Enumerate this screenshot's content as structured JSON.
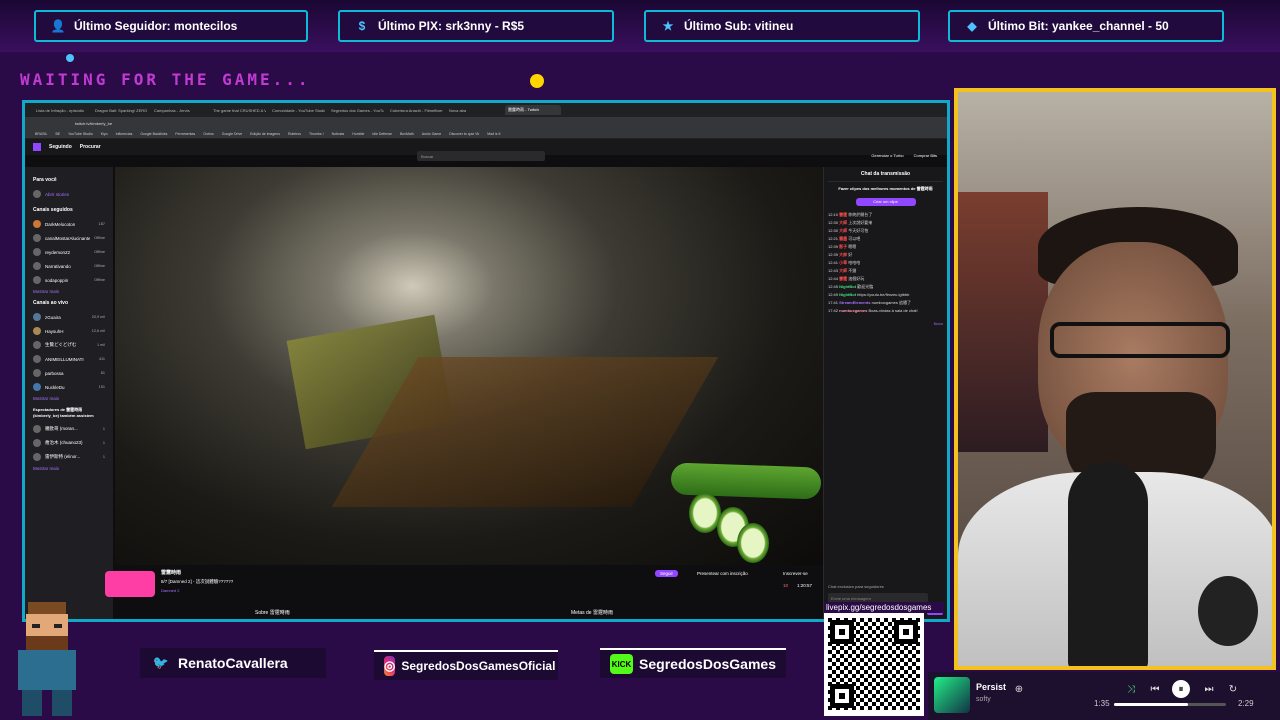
{
  "alerts": [
    {
      "icon": "user-icon",
      "label": "Último Seguidor: montecilos"
    },
    {
      "icon": "dollar-icon",
      "label": "Último PIX: srk3nny - R$5"
    },
    {
      "icon": "star-icon",
      "label": "Último Sub: vitineu"
    },
    {
      "icon": "diamond-icon",
      "label": "Último Bit: yankee_channel - 50"
    }
  ],
  "waiting_text": "WAITING FOR THE GAME...",
  "browser": {
    "tabs": [
      "Lista de Infração - episódio",
      "Dragon Ball: Sparking! ZERO",
      "Campanhas - Jervis",
      "The game that CRUSHED A VR",
      "Comunidade - YouTube Studio",
      "Segredos dos Games - YouTube",
      "Cobertura Anachi - Filmeflixer",
      "Nova aba",
      "雷霆時雨 - Twitch"
    ],
    "address": "twitch.tv/kimberly_be",
    "bookmarks": [
      "BRASIL",
      "BE",
      "YouTube Studio",
      "Kiyo",
      "Influencias",
      "Google Backlinks",
      "Ferramentas",
      "Outros",
      "Google Drive",
      "Edição de imagens",
      "Roteiros",
      "Thumbs !",
      "Notícias",
      "Humble",
      "Idle Defense",
      "BoxMath",
      "Anúlo Game",
      "Discover to quiz Vk",
      "Mad is It"
    ],
    "nav": {
      "following": "Seguindo",
      "browse": "Procurar",
      "search_placeholder": "Buscar",
      "turbo": "Gerenciar o Turbo",
      "bits": "Comprar Bits"
    }
  },
  "sidebar": {
    "for_you": "Para você",
    "alerts_label": "Abrir stories",
    "followed_title": "Canais seguidos",
    "followed": [
      {
        "name": "DarkMelocoton",
        "game": "Fortnite",
        "viewers": "187"
      },
      {
        "name": "canalMostarAlucinante",
        "game": "",
        "viewers": "Offline"
      },
      {
        "name": "reydemon22",
        "game": "",
        "viewers": "Offline"
      },
      {
        "name": "Narrativando",
        "game": "",
        "viewers": "Offline"
      },
      {
        "name": "sodapoppin",
        "game": "",
        "viewers": "Offline"
      }
    ],
    "show_more_1": "Mostrar mais",
    "live_title": "Canais ao vivo",
    "live": [
      {
        "name": "zGuaira",
        "game": "Battlefield 6",
        "viewers": "20,9 mil"
      },
      {
        "name": "HaysuhH",
        "game": "Battlefield 6",
        "viewers": "12,6 mil"
      },
      {
        "name": "生贄どぐどげむ",
        "game": "Street Fighter 6",
        "viewers": "1 mil"
      },
      {
        "name": "ANIMEILLUMINATI",
        "game": "BlazBlue: Central...",
        "viewers": "411"
      },
      {
        "name": "parbossa",
        "game": "Valorant",
        "viewers": "81"
      },
      {
        "name": "NuckleDu",
        "game": "Street Fighter 6",
        "viewers": "151"
      }
    ],
    "show_more_2": "Mostrar mais",
    "also_watch_title": "Espectadores de 雷霆時雨 (kimberly_be) também assistem",
    "also_watch": [
      {
        "name": "羅歐哥 (moran...",
        "game": "Overcooked! 2",
        "viewers": "1"
      },
      {
        "name": "喬治木 (chuano23)",
        "game": "Só Na Conversa",
        "viewers": "1"
      },
      {
        "name": "雷伊斯特 (elinor...",
        "game": "Mahjong Soul",
        "viewers": "1"
      }
    ],
    "show_more_3": "Mostrar mais"
  },
  "stream": {
    "channel": "雷霆時雨",
    "title": "8/7 [Damned 2] - 這次說體驗??????",
    "category": "Damned 2",
    "follow": "Seguir",
    "gift": "Presentear com inscrição",
    "subscribe": "Inscrever-se",
    "viewers": "10",
    "uptime": "1:20:57",
    "about": "Sobre 雷霆時雨",
    "goals": "Metas de 雷霆時雨"
  },
  "chat": {
    "header": "Chat da transmissão",
    "clips_title": "Fazer clipes dos melhores momentos de 雷霆時雨",
    "create_clip": "Criar um clipe",
    "messages": [
      {
        "time": "12:10",
        "user": "雷霆",
        "text": "你終於開台了"
      },
      {
        "time": "12:30",
        "user": "大師",
        "text": "上次說好要來"
      },
      {
        "time": "12:30",
        "user": "大師",
        "text": "今天好可怕"
      },
      {
        "time": "12:21",
        "user": "雲墨",
        "text": "可以吧"
      },
      {
        "time": "12:39",
        "user": "影子",
        "text": "嗯嗯"
      },
      {
        "time": "12:39",
        "user": "大帥",
        "text": "好"
      },
      {
        "time": "12:41",
        "user": "小草",
        "text": "哈哈哈"
      },
      {
        "time": "12:43",
        "user": "大師",
        "text": "不錯"
      },
      {
        "time": "12:44",
        "user": "雷霆",
        "text": "這個好玩"
      },
      {
        "time": "12:45",
        "user": "NightBot",
        "text": "歡迎光臨"
      },
      {
        "time": "12:49",
        "user": "NightBot",
        "text": "https://youtu.be/fimzeu.igtbbb"
      },
      {
        "time": "17:41",
        "user": "StreamElements",
        "text": "numbuxgames 追隨了"
      },
      {
        "time": "17:42",
        "user": "numbuxgames",
        "text": "Boas-vindas à sala de chat!"
      }
    ],
    "new_label": "Novo",
    "subs_only": "Chat exclusivo para seguidores",
    "input_placeholder": "Envie uma mensagem",
    "send": "Chat"
  },
  "socials": [
    {
      "icon": "twitter-icon",
      "label": "RenatoCavallera"
    },
    {
      "icon": "instagram-icon",
      "label": "SegredosDosGamesOficial"
    },
    {
      "icon": "kick-icon",
      "label": "SegredosDosGames"
    }
  ],
  "qr_url": "livepix.gg/segredosdosgames",
  "player": {
    "title": "Persist",
    "artist": "softy",
    "elapsed": "1:35",
    "duration": "2:29",
    "progress": 0.66
  },
  "colors": {
    "accent": "#12a9c9",
    "cam_border": "#f4c21c",
    "twitch": "#9147ff",
    "waiting": "#c23ad3"
  }
}
